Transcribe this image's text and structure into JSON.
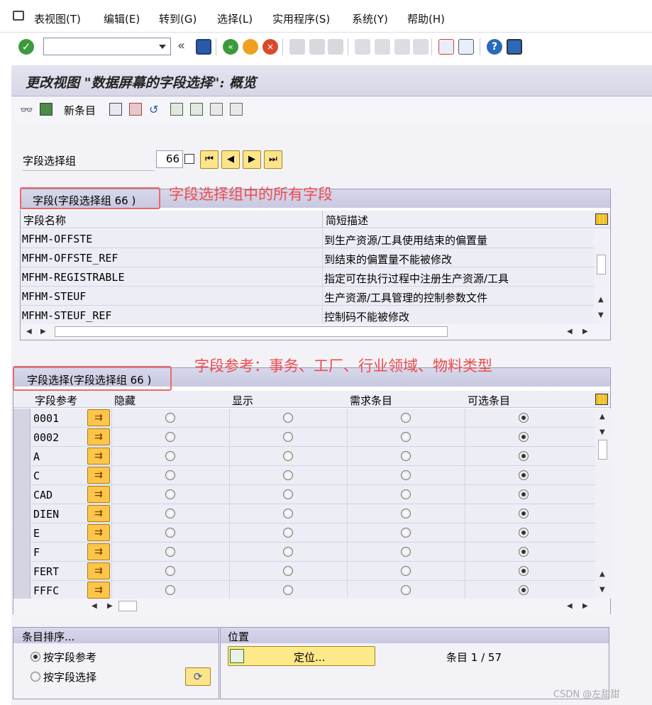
{
  "menu": {
    "items": [
      "表视图(T)",
      "编辑(E)",
      "转到(G)",
      "选择(L)",
      "实用程序(S)",
      "系统(Y)",
      "帮助(H)"
    ]
  },
  "title": "更改视图 \"数据屏幕的字段选择\": 概览",
  "app_toolbar": {
    "new_entries": "新条目"
  },
  "field_group": {
    "label": "字段选择组",
    "value": "66"
  },
  "annotations": {
    "fields": "字段选择组中的所有字段",
    "refs": "字段参考：事务、工厂、行业领域、物料类型"
  },
  "fields_table": {
    "title": "字段(字段选择组 66 )",
    "columns": [
      "字段名称",
      "简短描述"
    ],
    "rows": [
      {
        "name": "MFHM-OFFSTE",
        "desc": "到生产资源/工具使用结束的偏置量"
      },
      {
        "name": "MFHM-OFFSTE_REF",
        "desc": "到结束的偏置量不能被修改"
      },
      {
        "name": "MFHM-REGISTRABLE",
        "desc": "指定可在执行过程中注册生产资源/工具"
      },
      {
        "name": "MFHM-STEUF",
        "desc": "生产资源/工具管理的控制参数文件"
      },
      {
        "name": "MFHM-STEUF_REF",
        "desc": "控制码不能被修改"
      }
    ]
  },
  "selection_table": {
    "title": "字段选择(字段选择组 66 )",
    "columns": [
      "字段参考",
      "隐藏",
      "显示",
      "需求条目",
      "可选条目"
    ],
    "rows": [
      {
        "ref": "0001",
        "selected": 3
      },
      {
        "ref": "0002",
        "selected": 3
      },
      {
        "ref": "A",
        "selected": 3
      },
      {
        "ref": "C",
        "selected": 3
      },
      {
        "ref": "CAD",
        "selected": 3
      },
      {
        "ref": "DIEN",
        "selected": 3
      },
      {
        "ref": "E",
        "selected": 3
      },
      {
        "ref": "F",
        "selected": 3
      },
      {
        "ref": "FERT",
        "selected": 3
      },
      {
        "ref": "FFFC",
        "selected": 3
      }
    ]
  },
  "sort_panel": {
    "title": "条目排序...",
    "options": [
      "按字段参考",
      "按字段选择"
    ],
    "selected": 0
  },
  "position_panel": {
    "title": "位置",
    "button": "定位...",
    "entry_info": "条目 1 / 57"
  },
  "watermark": "CSDN @左甜甜"
}
